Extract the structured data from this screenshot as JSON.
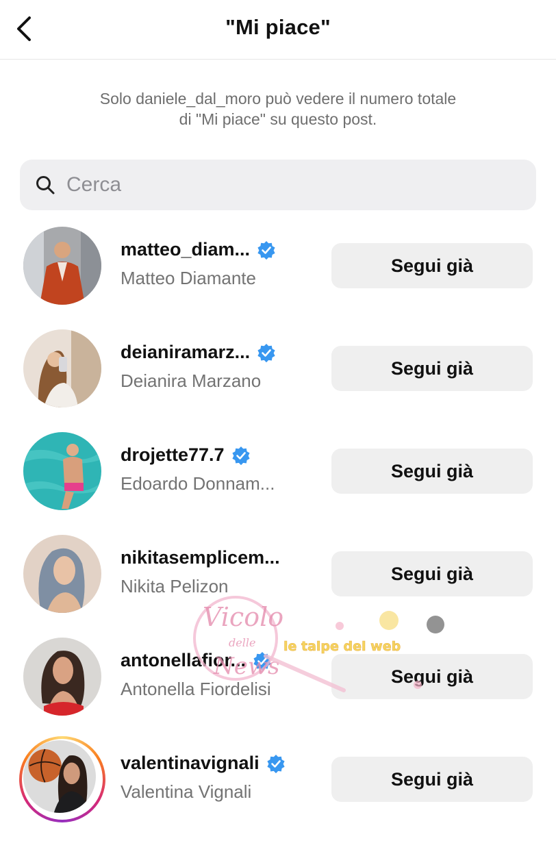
{
  "header": {
    "title": "\"Mi piace\"",
    "back_icon": "chevron-left-icon"
  },
  "notice": {
    "line1": "Solo daniele_dal_moro può vedere il numero totale",
    "line2": "di \"Mi piace\" su questo post."
  },
  "search": {
    "placeholder": "Cerca",
    "value": "",
    "icon": "search-icon"
  },
  "users": [
    {
      "username": "matteo_diam...",
      "full_name": "Matteo Diamante",
      "verified": true,
      "button": "Segui già"
    },
    {
      "username": "deianiramarz...",
      "full_name": "Deianira Marzano",
      "verified": true,
      "button": "Segui già"
    },
    {
      "username": "drojette77.7",
      "full_name": "Edoardo Donnam...",
      "verified": true,
      "button": "Segui già"
    },
    {
      "username": "nikitasemplicem...",
      "full_name": "Nikita Pelizon",
      "verified": false,
      "button": "Segui già"
    },
    {
      "username": "antonellafior...",
      "full_name": "Antonella Fiordelisi",
      "verified": true,
      "button": "Segui già"
    },
    {
      "username": "valentinavignali",
      "full_name": "Valentina Vignali",
      "verified": true,
      "button": "Segui già",
      "story_ring": true
    }
  ],
  "watermark": {
    "line1": "Vicolo",
    "line2": "delle",
    "line3": "News",
    "line4": "le talpe del web"
  },
  "colors": {
    "verified": "#3897f0",
    "button_bg": "#efefef",
    "search_bg": "#efeff1",
    "secondary_text": "#737373"
  }
}
